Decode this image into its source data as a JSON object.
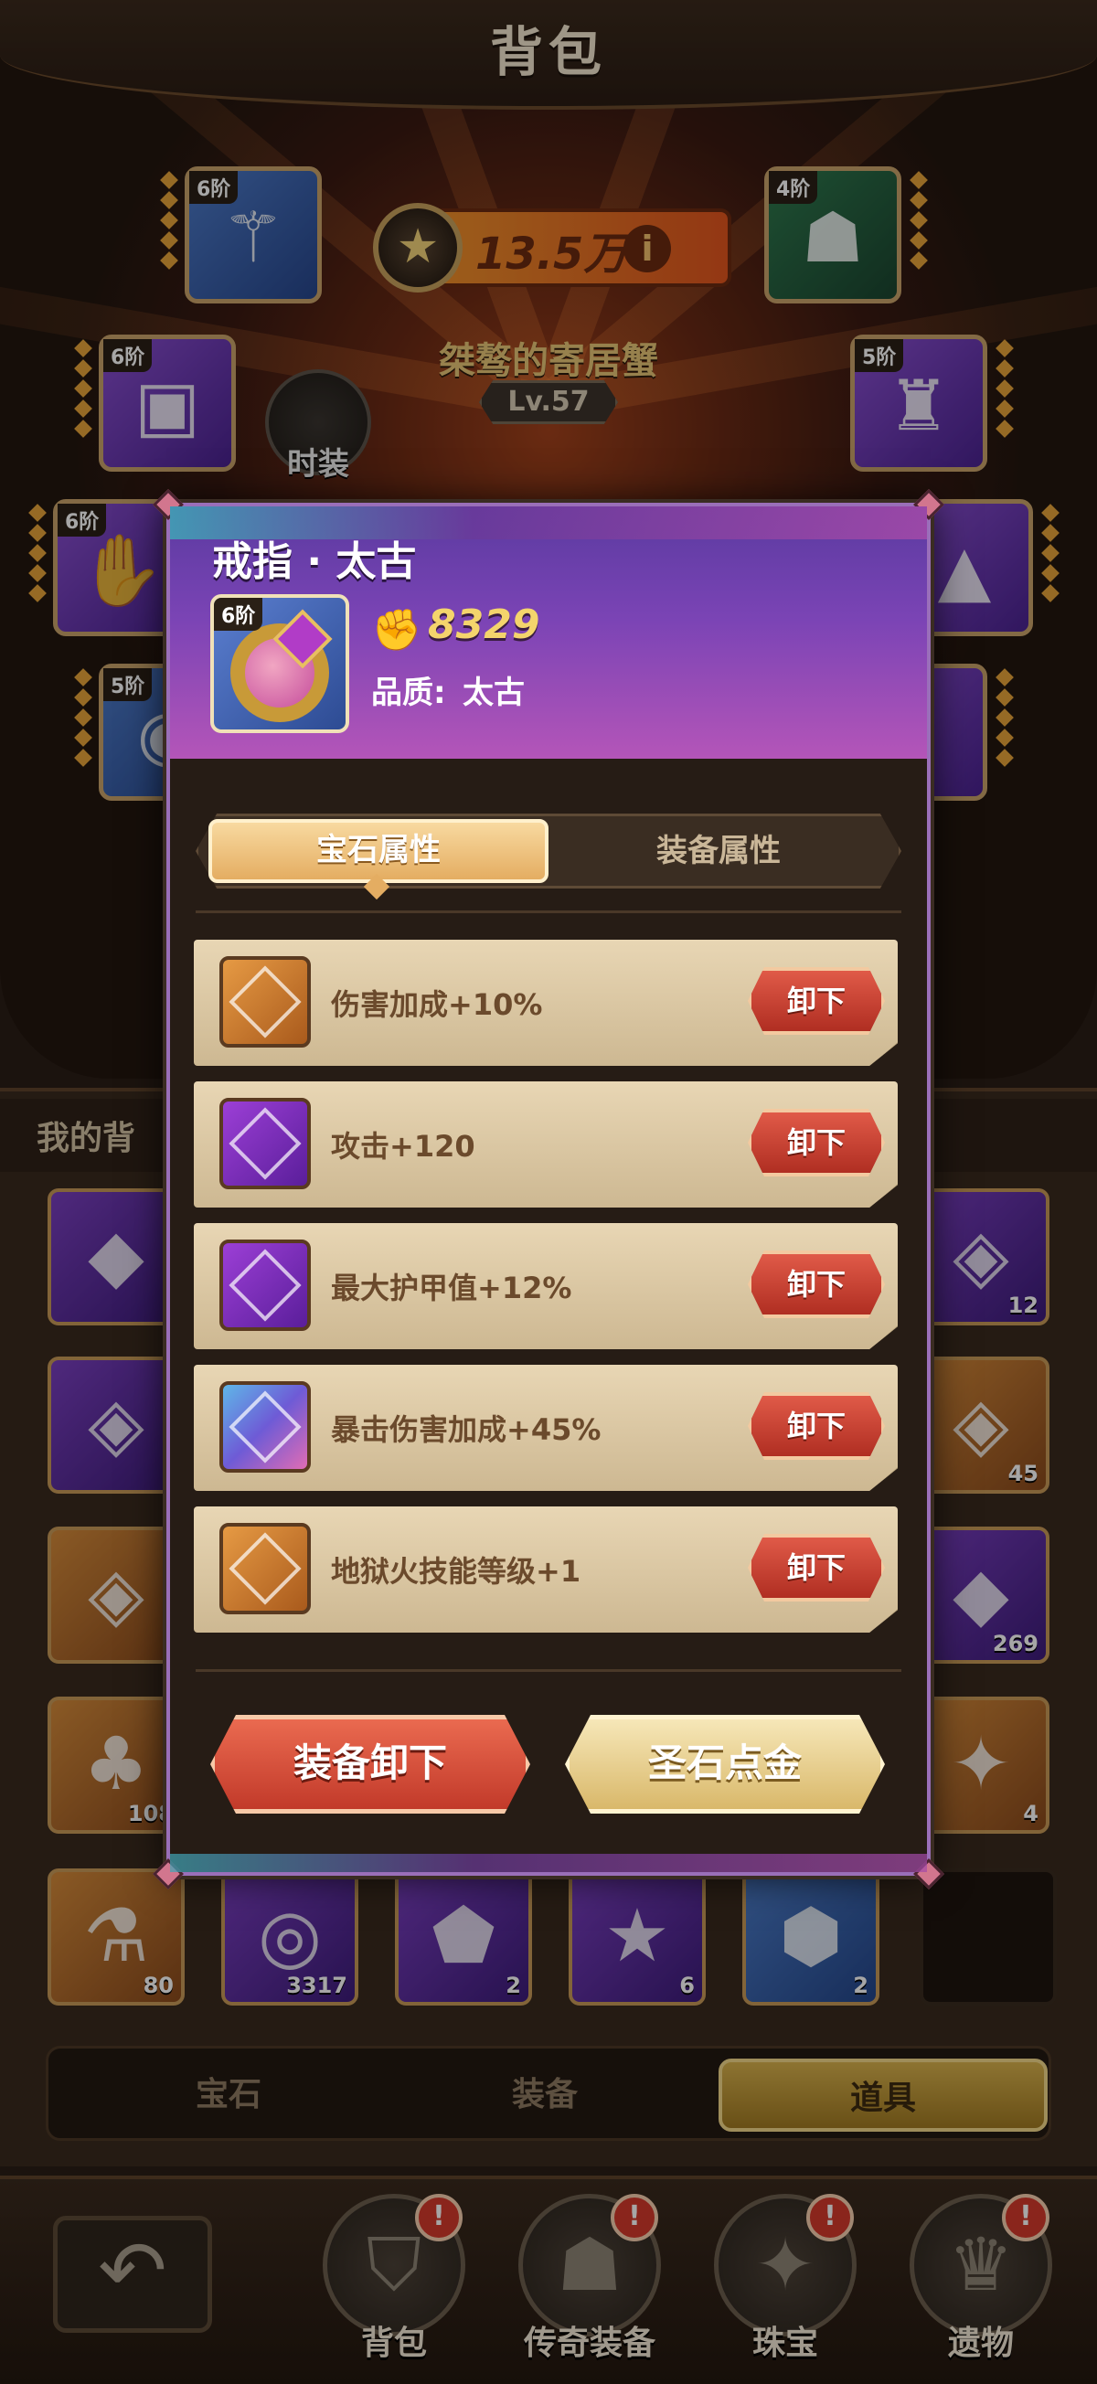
{
  "header": {
    "title": "背包"
  },
  "character": {
    "power": "13.5万",
    "name": "桀骜的寄居蟹",
    "level": "Lv.57",
    "outfit_label": "时装"
  },
  "equip_slots": [
    {
      "tier": "6阶",
      "icon": "staff-icon"
    },
    {
      "tier": "6阶",
      "icon": "book-icon"
    },
    {
      "tier": "6阶",
      "icon": "gauntlet-icon"
    },
    {
      "tier": "5阶",
      "icon": "amulet-icon"
    },
    {
      "tier": "4阶",
      "icon": "helmet-icon"
    },
    {
      "tier": "5阶",
      "icon": "cloak-icon"
    }
  ],
  "bag": {
    "header_text": "我的背",
    "items": [
      {
        "count": "80",
        "icon": "potion-icon"
      },
      {
        "count": "3317",
        "icon": "coin-icon"
      },
      {
        "count": "2",
        "icon": "ore-icon"
      },
      {
        "count": "6",
        "icon": "card-icon"
      },
      {
        "count": "2",
        "icon": "stone-icon"
      },
      {
        "count": "108",
        "icon": "clover-icon"
      },
      {
        "count": "12",
        "icon": "rune-icon"
      },
      {
        "count": "45",
        "icon": "rune-icon"
      },
      {
        "count": "269",
        "icon": "crystal-icon"
      },
      {
        "count": "4",
        "icon": "scroll-icon"
      }
    ],
    "tabs": [
      "宝石",
      "装备",
      "道具"
    ],
    "active_tab": "道具"
  },
  "nav": {
    "items": [
      {
        "label": "背包",
        "badge": "!"
      },
      {
        "label": "传奇装备",
        "badge": "!"
      },
      {
        "label": "珠宝",
        "badge": "!"
      },
      {
        "label": "遗物",
        "badge": "!"
      }
    ]
  },
  "modal": {
    "item_name": "戒指 · 太古",
    "tier": "6阶",
    "power": "8329",
    "quality_label": "品质:",
    "quality_value": "太古",
    "tabs": {
      "gem": "宝石属性",
      "equip": "装备属性"
    },
    "active_tab": "gem",
    "gems": [
      {
        "color": "orange",
        "text": "伤害加成+10%",
        "button": "卸下"
      },
      {
        "color": "purple",
        "text": "攻击+120",
        "button": "卸下"
      },
      {
        "color": "purple",
        "text": "最大护甲值+12%",
        "button": "卸下"
      },
      {
        "color": "rainbow",
        "text": "暴击伤害加成+45%",
        "button": "卸下"
      },
      {
        "color": "orange",
        "text": "地狱火技能等级+1",
        "button": "卸下"
      }
    ],
    "buttons": {
      "unequip": "装备卸下",
      "goldify": "圣石点金"
    }
  }
}
